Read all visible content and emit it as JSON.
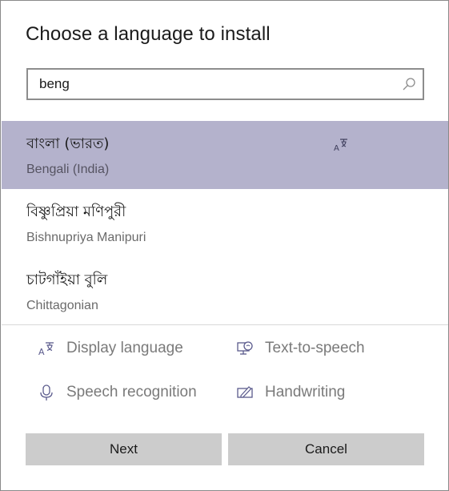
{
  "dialog": {
    "title": "Choose a language to install"
  },
  "search": {
    "value": "beng",
    "placeholder": ""
  },
  "languages": [
    {
      "native": "বাংলা (ভারত)",
      "english": "Bengali (India)",
      "selected": true,
      "feature_icon": "display-language-icon"
    },
    {
      "native": "বিষ্ণুপ্রিয়া মণিপুরী",
      "english": "Bishnupriya Manipuri",
      "selected": false
    },
    {
      "native": "চাটগাঁইয়া বুলি",
      "english": "Chittagonian",
      "selected": false
    }
  ],
  "features": [
    {
      "label": "Display language",
      "icon": "display-language-icon"
    },
    {
      "label": "Text-to-speech",
      "icon": "text-to-speech-icon"
    },
    {
      "label": "Speech recognition",
      "icon": "microphone-icon"
    },
    {
      "label": "Handwriting",
      "icon": "handwriting-icon"
    }
  ],
  "buttons": {
    "next": "Next",
    "cancel": "Cancel"
  },
  "colors": {
    "selected_row": "#b4b2cc",
    "icon_accent": "#5a5a8c",
    "button_bg": "#cccccc"
  }
}
